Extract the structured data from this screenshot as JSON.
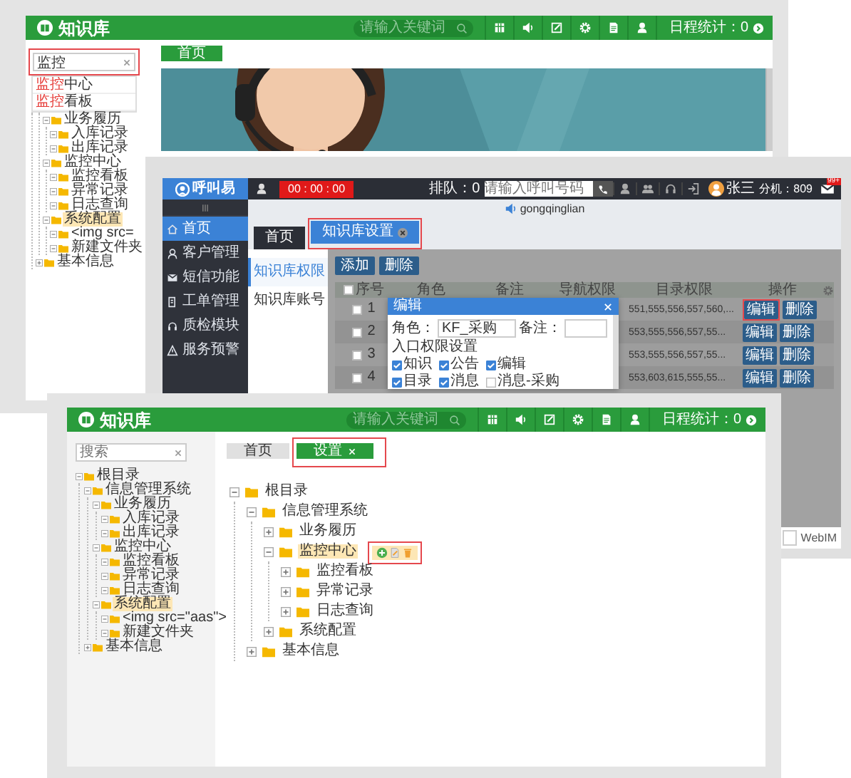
{
  "knowledge_base_back": {
    "header": {
      "title": "知识库",
      "search_placeholder": "请输入关键词",
      "stats": "日程统计：0"
    },
    "sidebar": {
      "search": {
        "value": "监控",
        "outlined": true
      },
      "suggestions": [
        {
          "match": "监控",
          "rest": "中心"
        },
        {
          "match": "监控",
          "rest": "看板"
        }
      ],
      "tree": [
        {
          "children": [
            {
              "children": [
                {
                  "label": "业务履历",
                  "expanded": true,
                  "selected": false,
                  "children": [
                    {
                      "label": "入库记录",
                      "expanded": true,
                      "selected": false
                    },
                    {
                      "label": "出库记录",
                      "expanded": true,
                      "selected": false
                    }
                  ]
                },
                {
                  "label": "监控中心",
                  "expanded": true,
                  "selected": false,
                  "children": [
                    {
                      "label": "监控看板",
                      "expanded": true,
                      "selected": false
                    },
                    {
                      "label": "异常记录",
                      "expanded": true,
                      "selected": false
                    },
                    {
                      "label": "日志查询",
                      "expanded": true,
                      "selected": false
                    }
                  ]
                },
                {
                  "label": "系统配置",
                  "expanded": true,
                  "selected": true,
                  "children": [
                    {
                      "label": "<img src=",
                      "expanded": true,
                      "selected": false
                    },
                    {
                      "label": "新建文件夹",
                      "expanded": true,
                      "selected": false
                    }
                  ]
                }
              ]
            },
            {
              "label": "基本信息",
              "expanded": false,
              "selected": false
            }
          ]
        }
      ]
    },
    "tabs": [
      {
        "label": "首页",
        "selected": true
      }
    ]
  },
  "call_center": {
    "header": {
      "logo": "呼叫易",
      "timer": "00 : 00 : 00",
      "queue": "排队：0",
      "dial_placeholder": "请输入呼叫号码",
      "user": "张三",
      "extension": "分机：809",
      "mail_badge": "99+"
    },
    "agent": "gongqinglian",
    "nav": [
      {
        "label": "首页",
        "kind": "home",
        "selected": true
      },
      {
        "label": "客户管理",
        "kind": "customers",
        "selected": false
      },
      {
        "label": "短信功能",
        "kind": "sms",
        "selected": false
      },
      {
        "label": "工单管理",
        "kind": "tickets",
        "selected": false
      },
      {
        "label": "质检模块",
        "kind": "quality",
        "selected": false
      },
      {
        "label": "服务预警",
        "kind": "alert",
        "selected": false
      }
    ],
    "tabs": [
      {
        "label": "首页",
        "selected": false
      },
      {
        "label": "知识库设置",
        "selected": true,
        "closable": true,
        "outlined": true
      }
    ],
    "subnav": [
      {
        "label": "知识库权限",
        "selected": true
      },
      {
        "label": "知识库账号",
        "selected": false
      }
    ],
    "toolbar": [
      "添加",
      "删除"
    ],
    "table": {
      "columns": [
        "序号",
        "角色",
        "备注",
        "导航权限",
        "目录权限",
        "操作"
      ],
      "select_all_checked": false,
      "rows": [
        {
          "number": "1",
          "checked": false,
          "directory_permissions": "551,555,556,557,560,...",
          "actions": [
            {
              "label": "编辑",
              "outlined": true
            },
            {
              "label": "删除"
            }
          ]
        },
        {
          "number": "2",
          "checked": false,
          "directory_permissions": "553,555,556,557,55...",
          "actions": [
            {
              "label": "编辑"
            },
            {
              "label": "删除"
            }
          ]
        },
        {
          "number": "3",
          "checked": false,
          "directory_permissions": "553,555,556,557,55...",
          "actions": [
            {
              "label": "编辑"
            },
            {
              "label": "删除"
            }
          ]
        },
        {
          "number": "4",
          "checked": false,
          "directory_permissions": "553,603,615,555,55...",
          "actions": [
            {
              "label": "编辑"
            },
            {
              "label": "删除"
            }
          ]
        }
      ]
    },
    "dialog": {
      "title": "编辑",
      "fields": [
        {
          "label": "角色：",
          "value": "KF_采购"
        },
        {
          "label": "备注："
        }
      ],
      "section": "入口权限设置",
      "options": [
        {
          "label": "知识",
          "checked": true
        },
        {
          "label": "公告",
          "checked": true
        },
        {
          "label": "编辑",
          "checked": true
        },
        {
          "label": "目录",
          "checked": true
        },
        {
          "label": "消息",
          "checked": true
        },
        {
          "label": "消息-采购",
          "checked": false
        }
      ]
    },
    "footer": {
      "label": "WebIM"
    }
  },
  "knowledge_base_front": {
    "header": {
      "title": "知识库",
      "search_placeholder": "请输入关键词",
      "stats": "日程统计：0"
    },
    "sidebar": {
      "search": {
        "placeholder": "搜索"
      },
      "tree": [
        {
          "label": "根目录",
          "expanded": true,
          "selected": false,
          "children": [
            {
              "label": "信息管理系统",
              "expanded": true,
              "selected": false,
              "children": [
                {
                  "label": "业务履历",
                  "expanded": true,
                  "selected": false,
                  "children": [
                    {
                      "label": "入库记录",
                      "expanded": true,
                      "selected": false
                    },
                    {
                      "label": "出库记录",
                      "expanded": true,
                      "selected": false
                    }
                  ]
                },
                {
                  "label": "监控中心",
                  "expanded": true,
                  "selected": false,
                  "children": [
                    {
                      "label": "监控看板",
                      "expanded": true,
                      "selected": false
                    },
                    {
                      "label": "异常记录",
                      "expanded": true,
                      "selected": false
                    },
                    {
                      "label": "日志查询",
                      "expanded": true,
                      "selected": false
                    }
                  ]
                },
                {
                  "label": "系统配置",
                  "expanded": true,
                  "selected": true,
                  "children": [
                    {
                      "label": "<img src=\"aas\">",
                      "expanded": true,
                      "selected": false
                    },
                    {
                      "label": "新建文件夹",
                      "expanded": true,
                      "selected": false
                    }
                  ]
                }
              ]
            },
            {
              "label": "基本信息",
              "expanded": false,
              "selected": false
            }
          ]
        }
      ]
    },
    "tabs": [
      {
        "label": "首页",
        "selected": false
      },
      {
        "label": "设置",
        "selected": true,
        "closable": true,
        "outlined": true
      }
    ],
    "tree": [
      {
        "label": "根目录",
        "expanded": true,
        "selected": false,
        "children": [
          {
            "label": "信息管理系统",
            "expanded": true,
            "selected": false,
            "children": [
              {
                "label": "业务履历",
                "expanded": false,
                "selected": false
              },
              {
                "label": "监控中心",
                "expanded": true,
                "selected": true,
                "actions_outlined": true,
                "children": [
                  {
                    "label": "监控看板",
                    "expanded": false,
                    "selected": false
                  },
                  {
                    "label": "异常记录",
                    "expanded": false,
                    "selected": false
                  },
                  {
                    "label": "日志查询",
                    "expanded": false,
                    "selected": false
                  }
                ]
              },
              {
                "label": "系统配置",
                "expanded": false,
                "selected": false
              }
            ]
          },
          {
            "label": "基本信息",
            "expanded": false,
            "selected": false
          }
        ]
      }
    ]
  }
}
